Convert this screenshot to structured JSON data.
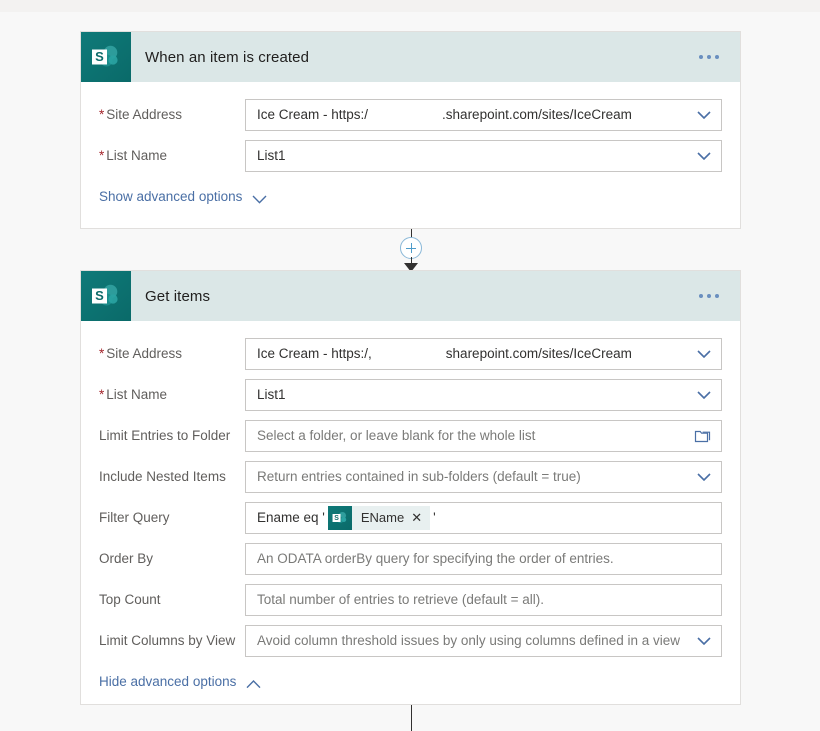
{
  "app": {
    "background_color": "#f8f8f8",
    "header_color": "#dbe7e7",
    "accent_color": "#0f7a79",
    "link_color": "#4a6fa5"
  },
  "cards": [
    {
      "id": "trigger",
      "icon": "sharepoint-icon",
      "title": "When an item is created",
      "menu": "overflow-menu",
      "fields": [
        {
          "name": "site-address",
          "label": "Site Address",
          "required": true,
          "value_prefix": "Ice Cream  -  https:/",
          "value_suffix": ".sharepoint.com/sites/IceCream",
          "redacted": true,
          "control": "combobox",
          "icon": "chevron-down-icon"
        },
        {
          "name": "list-name",
          "label": "List Name",
          "required": true,
          "value": "List1",
          "control": "combobox",
          "icon": "chevron-down-icon"
        }
      ],
      "advanced_toggle": {
        "label": "Show advanced options",
        "icon": "chevron-down-icon"
      }
    },
    {
      "id": "get-items",
      "icon": "sharepoint-icon",
      "title": "Get items",
      "menu": "overflow-menu",
      "fields": [
        {
          "name": "site-address",
          "label": "Site Address",
          "required": true,
          "value_prefix": "Ice Cream  -  https:/,",
          "value_suffix": "sharepoint.com/sites/IceCream",
          "redacted": true,
          "control": "combobox",
          "icon": "chevron-down-icon"
        },
        {
          "name": "list-name",
          "label": "List Name",
          "required": true,
          "value": "List1",
          "control": "combobox",
          "icon": "chevron-down-icon"
        },
        {
          "name": "limit-entries-to-folder",
          "label": "Limit Entries to Folder",
          "required": false,
          "placeholder": "Select a folder, or leave blank for the whole list",
          "control": "picker",
          "icon": "folder-icon"
        },
        {
          "name": "include-nested-items",
          "label": "Include Nested Items",
          "required": false,
          "placeholder": "Return entries contained in sub-folders (default = true)",
          "control": "combobox",
          "icon": "chevron-down-icon"
        },
        {
          "name": "filter-query",
          "label": "Filter Query",
          "required": false,
          "control": "token-input",
          "text_before": "Ename eq '",
          "token": {
            "icon": "sharepoint-icon",
            "label": "EName",
            "remove_icon": "close-icon",
            "remove_glyph": "✕"
          },
          "text_after": "'"
        },
        {
          "name": "order-by",
          "label": "Order By",
          "required": false,
          "placeholder": "An ODATA orderBy query for specifying the order of entries.",
          "control": "text"
        },
        {
          "name": "top-count",
          "label": "Top Count",
          "required": false,
          "placeholder": "Total number of entries to retrieve (default = all).",
          "control": "text"
        },
        {
          "name": "limit-columns-by-view",
          "label": "Limit Columns by View",
          "required": false,
          "placeholder": "Avoid column threshold issues by only using columns defined in a view",
          "control": "combobox",
          "icon": "chevron-down-icon"
        }
      ],
      "advanced_toggle": {
        "label": "Hide advanced options",
        "icon": "chevron-up-icon"
      }
    }
  ],
  "connector": {
    "add_step_button": "add-step-plus-button",
    "arrow": "flow-arrow"
  }
}
